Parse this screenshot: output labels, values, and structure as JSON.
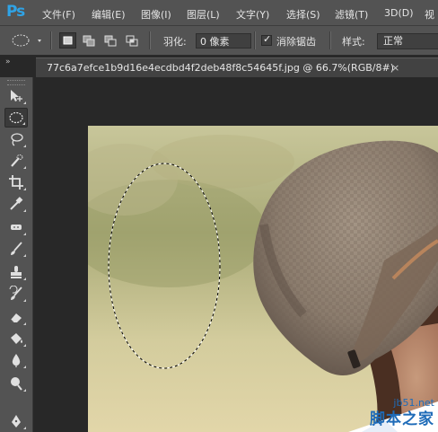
{
  "app": {
    "logo": "Ps"
  },
  "menu": [
    "文件(F)",
    "编辑(E)",
    "图像(I)",
    "图层(L)",
    "文字(Y)",
    "选择(S)",
    "滤镜(T)",
    "3D(D)",
    "视"
  ],
  "options": {
    "feather_label": "羽化:",
    "feather_value": "0 像素",
    "antialias_label": "消除锯齿",
    "antialias_checked": true,
    "style_label": "样式:",
    "style_value": "正常"
  },
  "document_tab": {
    "title": "77c6a7efce1b9d16e4ecdbd4f2deb48f8c54645f.jpg @ 66.7%(RGB/8#)",
    "close": "×"
  },
  "tools": [
    "move-tool",
    "elliptical-marquee-tool",
    "lasso-tool",
    "quick-selection-tool",
    "crop-tool",
    "eyedropper-tool",
    "spot-healing-brush-tool",
    "brush-tool",
    "clone-stamp-tool",
    "history-brush-tool",
    "eraser-tool",
    "paint-bucket-tool",
    "blur-tool",
    "dodge-tool",
    "pen-tool"
  ],
  "active_tool": "elliptical-marquee-tool",
  "watermark": {
    "site": "jb51.net",
    "name": "脚本之家"
  },
  "colors": {
    "panel": "#535353",
    "workspace": "#282828",
    "ps_blue": "#2fa3e6",
    "watermark": "#1e6bb8"
  }
}
